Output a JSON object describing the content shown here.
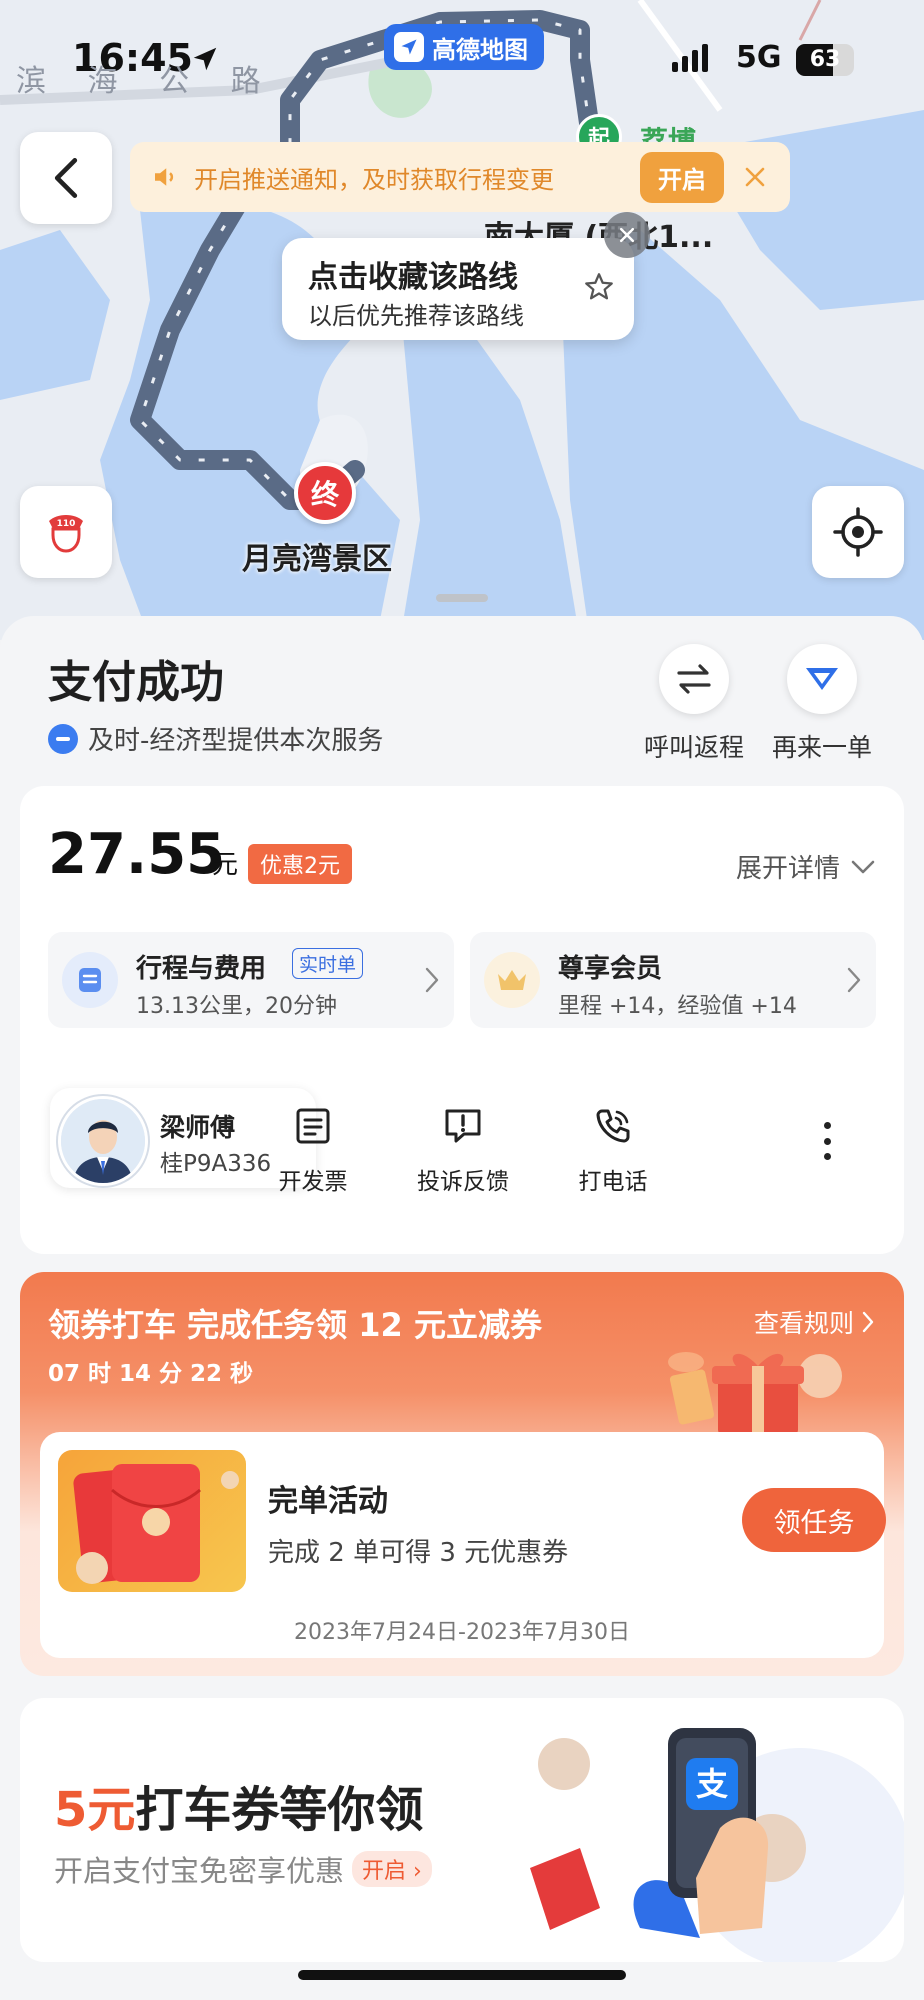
{
  "status_bar": {
    "time": "16:45",
    "network": "5G",
    "battery": "63",
    "battery_level": 0.63
  },
  "map": {
    "app_badge": "高德地图",
    "road_label": "滨 海 公 路",
    "top_place_partial": "荔博",
    "start_pin": "起",
    "end_pin": "终",
    "destination_label": "月亮湾景区",
    "partial_place": "南大厦 (西北1...",
    "route_color": "#5a6b86",
    "water_color": "#b9d3f5"
  },
  "notice": {
    "text": "开启推送通知，及时获取行程变更",
    "button": "开启"
  },
  "favorite_tip": {
    "title": "点击收藏该路线",
    "subtitle": "以后优先推荐该路线"
  },
  "summary": {
    "title": "支付成功",
    "provider": "及时-经济型提供本次服务",
    "actions": [
      {
        "label": "呼叫返程",
        "icon": "swap-arrows-icon"
      },
      {
        "label": "再来一单",
        "icon": "send-icon"
      }
    ]
  },
  "fare": {
    "amount": "27.55",
    "unit": "元",
    "discount": "优惠2元",
    "expand": "展开详情",
    "trip_tile": {
      "title": "行程与费用",
      "badge": "实时单",
      "subtitle": "13.13公里，20分钟"
    },
    "member_tile": {
      "title": "尊享会员",
      "subtitle": "里程 +14，经验值 +14"
    }
  },
  "driver": {
    "name": "梁师傅",
    "plate": "桂P9A336",
    "actions": [
      {
        "label": "开发票",
        "icon": "invoice-icon"
      },
      {
        "label": "投诉反馈",
        "icon": "feedback-icon"
      },
      {
        "label": "打电话",
        "icon": "phone-icon"
      }
    ]
  },
  "promo": {
    "title": "领券打车 完成任务领 12 元立减券",
    "timer": "07 时 14 分 22 秒",
    "rules": "查看规则",
    "task": {
      "title": "完单活动",
      "subtitle": "完成 2 单可得 3 元优惠券",
      "button": "领任务",
      "date_range": "2023年7月24日-2023年7月30日"
    }
  },
  "alipay": {
    "title_accent": "5元",
    "title_rest": "打车券等你领",
    "subtitle": "开启支付宝免密享优惠",
    "open": "开启",
    "app_glyph": "支"
  }
}
